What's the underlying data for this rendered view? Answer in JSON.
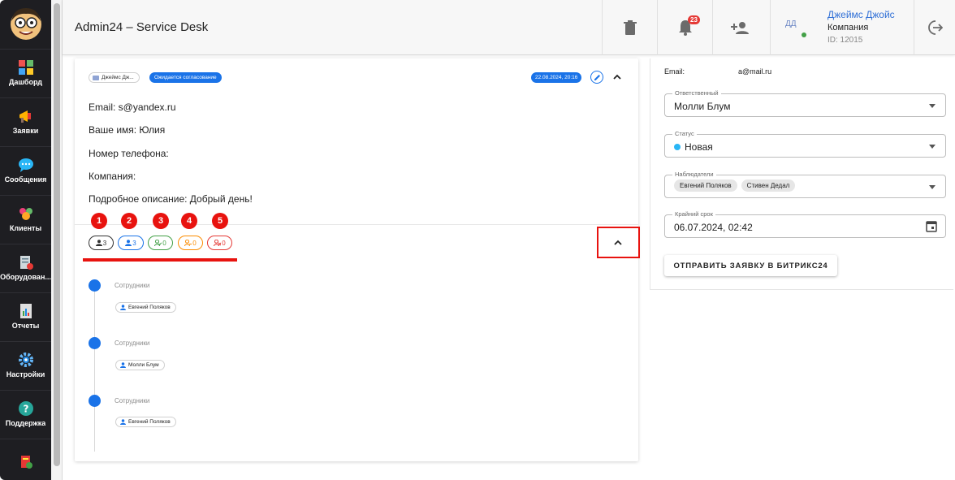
{
  "header": {
    "title": "Admin24 – Service Desk",
    "notifications_count": "23",
    "user": {
      "avatar_initials": "ДД",
      "name": "Джеймс Джойс",
      "company": "Компания",
      "id": "ID: 12015"
    }
  },
  "sidebar": {
    "items": [
      {
        "label": "Дашборд",
        "icon": "dashboard-icon"
      },
      {
        "label": "Заявки",
        "icon": "megaphone-icon"
      },
      {
        "label": "Сообщения",
        "icon": "chat-bubble-icon"
      },
      {
        "label": "Клиенты",
        "icon": "people-icon"
      },
      {
        "label": "Оборудован...",
        "icon": "equipment-icon"
      },
      {
        "label": "Отчеты",
        "icon": "report-icon"
      },
      {
        "label": "Настройки",
        "icon": "gear-icon"
      },
      {
        "label": "Поддержка",
        "icon": "help-icon"
      }
    ]
  },
  "ticket": {
    "author_chip": "Джеймс Дж...",
    "status_chip": "Ожидается согласование",
    "date_chip": "22.08.2024, 20:16",
    "lines": [
      "Email: s@yandex.ru",
      "Ваше имя: Юлия",
      "Номер телефона:",
      "Компания:",
      "Подробное описание: Добрый день!"
    ],
    "markers": [
      "1",
      "2",
      "3",
      "4",
      "5"
    ],
    "counts": [
      {
        "value": "3",
        "color": "#333333"
      },
      {
        "value": "3",
        "color": "#1a73e8"
      },
      {
        "value": "0",
        "color": "#43a047"
      },
      {
        "value": "0",
        "color": "#fb8c00"
      },
      {
        "value": "0",
        "color": "#e53935"
      }
    ],
    "timeline": [
      {
        "label": "Сотрудники",
        "person": "Евгений Поляков"
      },
      {
        "label": "Сотрудники",
        "person": "Молли Блум"
      },
      {
        "label": "Сотрудники",
        "person": "Евгений Поляков"
      }
    ]
  },
  "panel": {
    "email_label": "Email:",
    "email_value": "a@mail.ru",
    "responsible": {
      "label": "Ответственный",
      "value": "Молли Блум"
    },
    "status": {
      "label": "Статус",
      "value": "Новая"
    },
    "observers": {
      "label": "Наблюдатели",
      "chips": [
        "Евгений Поляков",
        "Стивен Дедал"
      ]
    },
    "deadline": {
      "label": "Крайний срок",
      "value": "06.07.2024, 02:42"
    },
    "send_button": "ОТПРАВИТЬ ЗАЯВКУ В БИТРИКС24"
  },
  "colors": {
    "accent": "#1a73e8",
    "annotation_red": "#e8130f",
    "sidebar_bg": "#1e1e22"
  }
}
